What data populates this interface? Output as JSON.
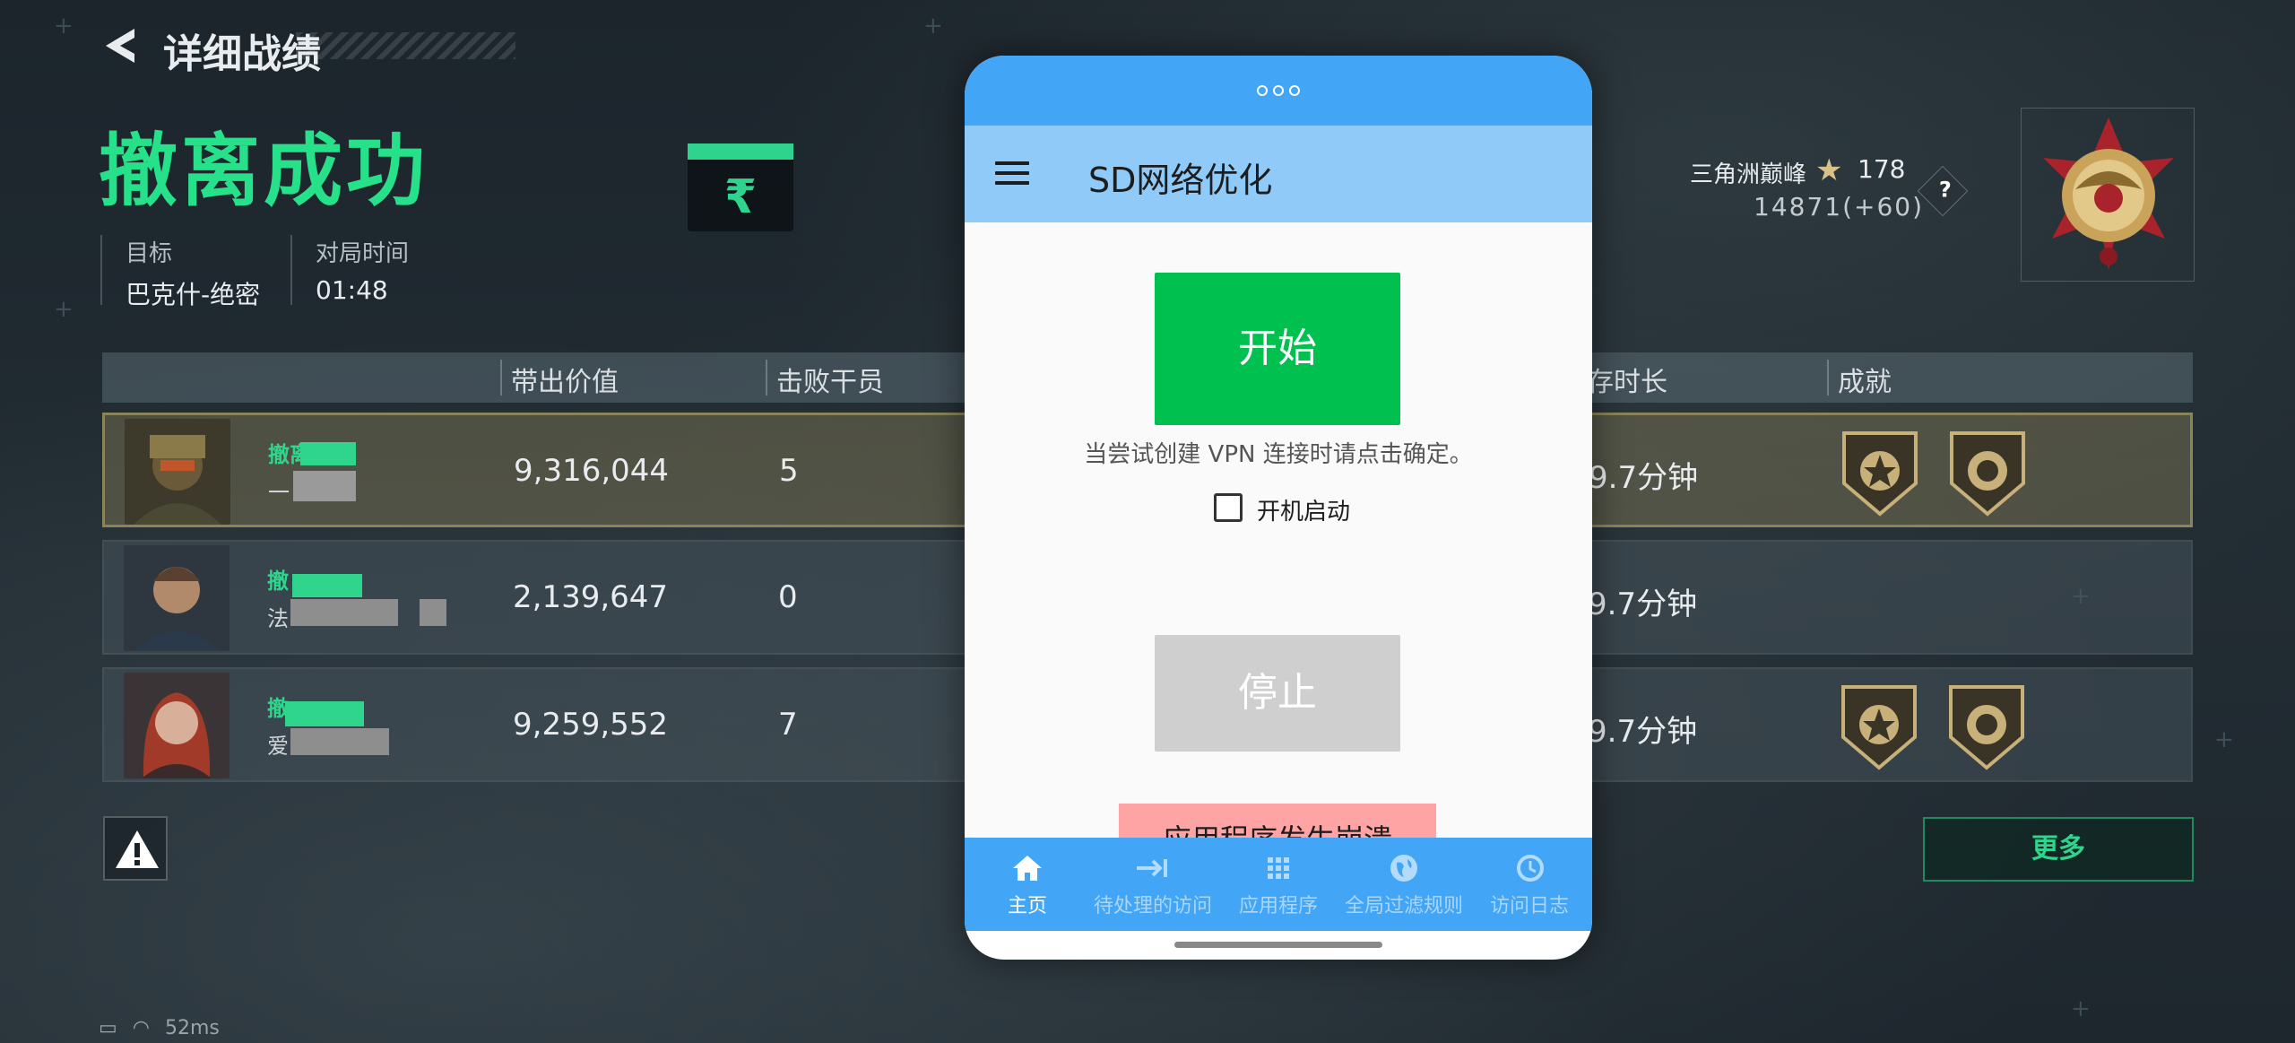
{
  "header": {
    "title": "详细战绩"
  },
  "result": {
    "title": "撤离成功",
    "currency_symbol": "₹"
  },
  "info": {
    "target_label": "目标",
    "target_value": "巴克什-绝密",
    "duration_label": "对局时间",
    "duration_value": "01:48"
  },
  "rank": {
    "label": "三角洲巅峰",
    "level": "178",
    "score": "14871(+60)",
    "help": "?"
  },
  "table": {
    "headers": {
      "value": "带出价值",
      "kills": "击败干员",
      "survival": "存时长",
      "achievements": "成就"
    },
    "rows": [
      {
        "tag": "撤离",
        "sub": "一",
        "value": "9,316,044",
        "kills": "5",
        "survival": "9.7分钟",
        "medals": 2
      },
      {
        "tag": "撤",
        "sub": "法",
        "value": "2,139,647",
        "kills": "0",
        "survival": "9.7分钟",
        "medals": 0
      },
      {
        "tag": "撤",
        "sub": "爱",
        "value": "9,259,552",
        "kills": "7",
        "survival": "9.7分钟",
        "medals": 2
      }
    ]
  },
  "actions": {
    "more": "更多"
  },
  "status": {
    "ping": "52ms"
  },
  "phone": {
    "app_title": "SD网络优化",
    "start": "开始",
    "hint": "当尝试创建 VPN 连接时请点击确定。",
    "autostart": "开机启动",
    "stop": "停止",
    "crash": "应用程序发生崩溃",
    "nav": [
      {
        "icon": "home-icon",
        "label": "主页"
      },
      {
        "icon": "pending-icon",
        "label": "待处理的访问"
      },
      {
        "icon": "apps-grid-icon",
        "label": "应用程序"
      },
      {
        "icon": "globe-icon",
        "label": "全局过滤规则"
      },
      {
        "icon": "history-icon",
        "label": "访问日志"
      }
    ]
  },
  "colors": {
    "accent_green": "#27e08a",
    "phone_blue": "#42a5f5",
    "appbar_blue": "#90caf9",
    "start_green": "#00c050",
    "crash_pink": "#ffa4a4"
  }
}
